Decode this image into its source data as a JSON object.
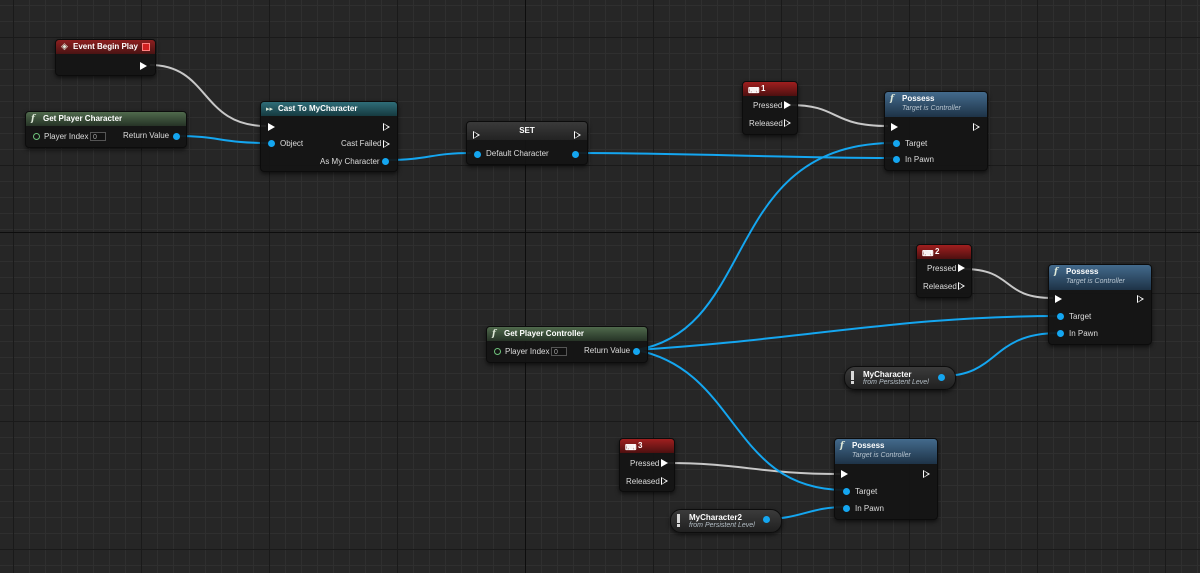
{
  "graph": {
    "event_begin_play": {
      "title": "Event Begin Play"
    },
    "get_player_character": {
      "title": "Get Player Character",
      "player_index_label": "Player Index",
      "player_index_value": "0",
      "return_label": "Return Value"
    },
    "cast_node": {
      "title": "Cast To MyCharacter",
      "object_label": "Object",
      "cast_failed_label": "Cast Failed",
      "as_label": "As My Character"
    },
    "set_node": {
      "title": "SET",
      "var_label": "Default Character"
    },
    "get_player_controller": {
      "title": "Get Player Controller",
      "player_index_label": "Player Index",
      "player_index_value": "0",
      "return_label": "Return Value"
    },
    "key_nodes": [
      {
        "label": "1",
        "pressed": "Pressed",
        "released": "Released"
      },
      {
        "label": "2",
        "pressed": "Pressed",
        "released": "Released"
      },
      {
        "label": "3",
        "pressed": "Pressed",
        "released": "Released"
      }
    ],
    "possess_nodes": [
      {
        "title": "Possess",
        "subtitle": "Target is Controller",
        "target_label": "Target",
        "pawn_label": "In Pawn"
      },
      {
        "title": "Possess",
        "subtitle": "Target is Controller",
        "target_label": "Target",
        "pawn_label": "In Pawn"
      },
      {
        "title": "Possess",
        "subtitle": "Target is Controller",
        "target_label": "Target",
        "pawn_label": "In Pawn"
      }
    ],
    "level_refs": [
      {
        "name": "MyCharacter",
        "subtitle": "from Persistent Level"
      },
      {
        "name": "MyCharacter2",
        "subtitle": "from Persistent Level"
      }
    ]
  },
  "colors": {
    "object_pin": "#14a6f0",
    "exec_wire": "#e0e0e0",
    "event_header": "#8d1f1f",
    "function_header": "#4f6a4c",
    "cast_header": "#2f6d78",
    "possess_header": "#436a8c"
  }
}
